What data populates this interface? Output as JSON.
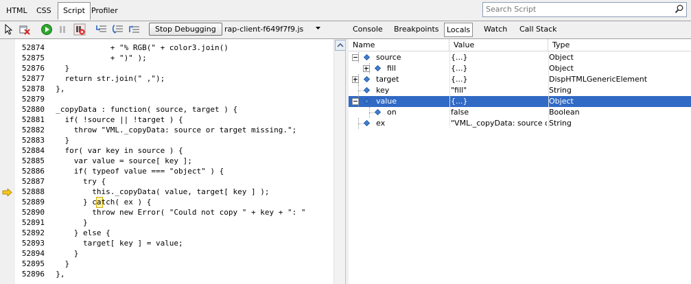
{
  "tabs": [
    "HTML",
    "CSS",
    "Script",
    "Profiler"
  ],
  "active_tab": 2,
  "search": {
    "placeholder": "Search Script"
  },
  "toolbar": {
    "stop_debugging_label": "Stop Debugging",
    "file_name": "rap-client-f649f7f9.js"
  },
  "right_tabs": [
    "Console",
    "Breakpoints",
    "Locals",
    "Watch",
    "Call Stack"
  ],
  "active_right_tab": 2,
  "code": {
    "lines": [
      {
        "num": "52874",
        "text": "              + \"% RGB(\" + color3.join()"
      },
      {
        "num": "52875",
        "text": "              + \")\" );"
      },
      {
        "num": "52876",
        "text": "    }"
      },
      {
        "num": "52877",
        "text": "    return str.join(\" ,\");"
      },
      {
        "num": "52878",
        "text": "  },"
      },
      {
        "num": "52879",
        "text": ""
      },
      {
        "num": "52880",
        "text": "  _copyData : function( source, target ) {"
      },
      {
        "num": "52881",
        "text": "    if( !source || !target ) {"
      },
      {
        "num": "52882",
        "text": "      throw \"VML._copyData: source or target missing.\";"
      },
      {
        "num": "52883",
        "text": "    }"
      },
      {
        "num": "52884",
        "text": "    for( var key in source ) {"
      },
      {
        "num": "52885",
        "text": "      var value = source[ key ];"
      },
      {
        "num": "52886",
        "text": "      if( typeof value === \"object\" ) {"
      },
      {
        "num": "52887",
        "text": "        try {"
      },
      {
        "num": "52888",
        "text": "          this._copyData( value, target[ key ] );"
      },
      {
        "num": "52889",
        "text": "        } catch( ex ) {"
      },
      {
        "num": "52890",
        "text": "          throw new Error( \"Could not copy \" + key + \": \""
      },
      {
        "num": "52891",
        "text": "        }"
      },
      {
        "num": "52892",
        "text": "      } else {"
      },
      {
        "num": "52893",
        "text": "        target[ key ] = value;"
      },
      {
        "num": "52894",
        "text": "      }"
      },
      {
        "num": "52895",
        "text": "    }"
      },
      {
        "num": "52896",
        "text": "  },"
      }
    ],
    "current_line_index": 14
  },
  "locals": {
    "headers": {
      "name": "Name",
      "value": "Value",
      "type": "Type"
    },
    "rows": [
      {
        "name": "source",
        "value": "{...}",
        "type": "Object",
        "level": 0,
        "expander": "minus"
      },
      {
        "name": "fill",
        "value": "{...}",
        "type": "Object",
        "level": 1,
        "expander": "plus"
      },
      {
        "name": "target",
        "value": "{...}",
        "type": "DispHTMLGenericElement",
        "level": 0,
        "expander": "plus"
      },
      {
        "name": "key",
        "value": "\"fill\"",
        "type": "String",
        "level": 0,
        "expander": "none"
      },
      {
        "name": "value",
        "value": "{...}",
        "type": "Object",
        "level": 0,
        "expander": "minus",
        "selected": true
      },
      {
        "name": "on",
        "value": "false",
        "type": "Boolean",
        "level": 1,
        "expander": "none"
      },
      {
        "name": "ex",
        "value": "\"VML._copyData: source or...",
        "type": "String",
        "level": 0,
        "expander": "none"
      }
    ]
  },
  "icons": {
    "toolbar": [
      "select-element-icon",
      "clear-icon",
      "continue-icon",
      "break-icon",
      "break-on-error-icon",
      "step-into-icon",
      "step-over-icon",
      "step-out-icon"
    ]
  }
}
